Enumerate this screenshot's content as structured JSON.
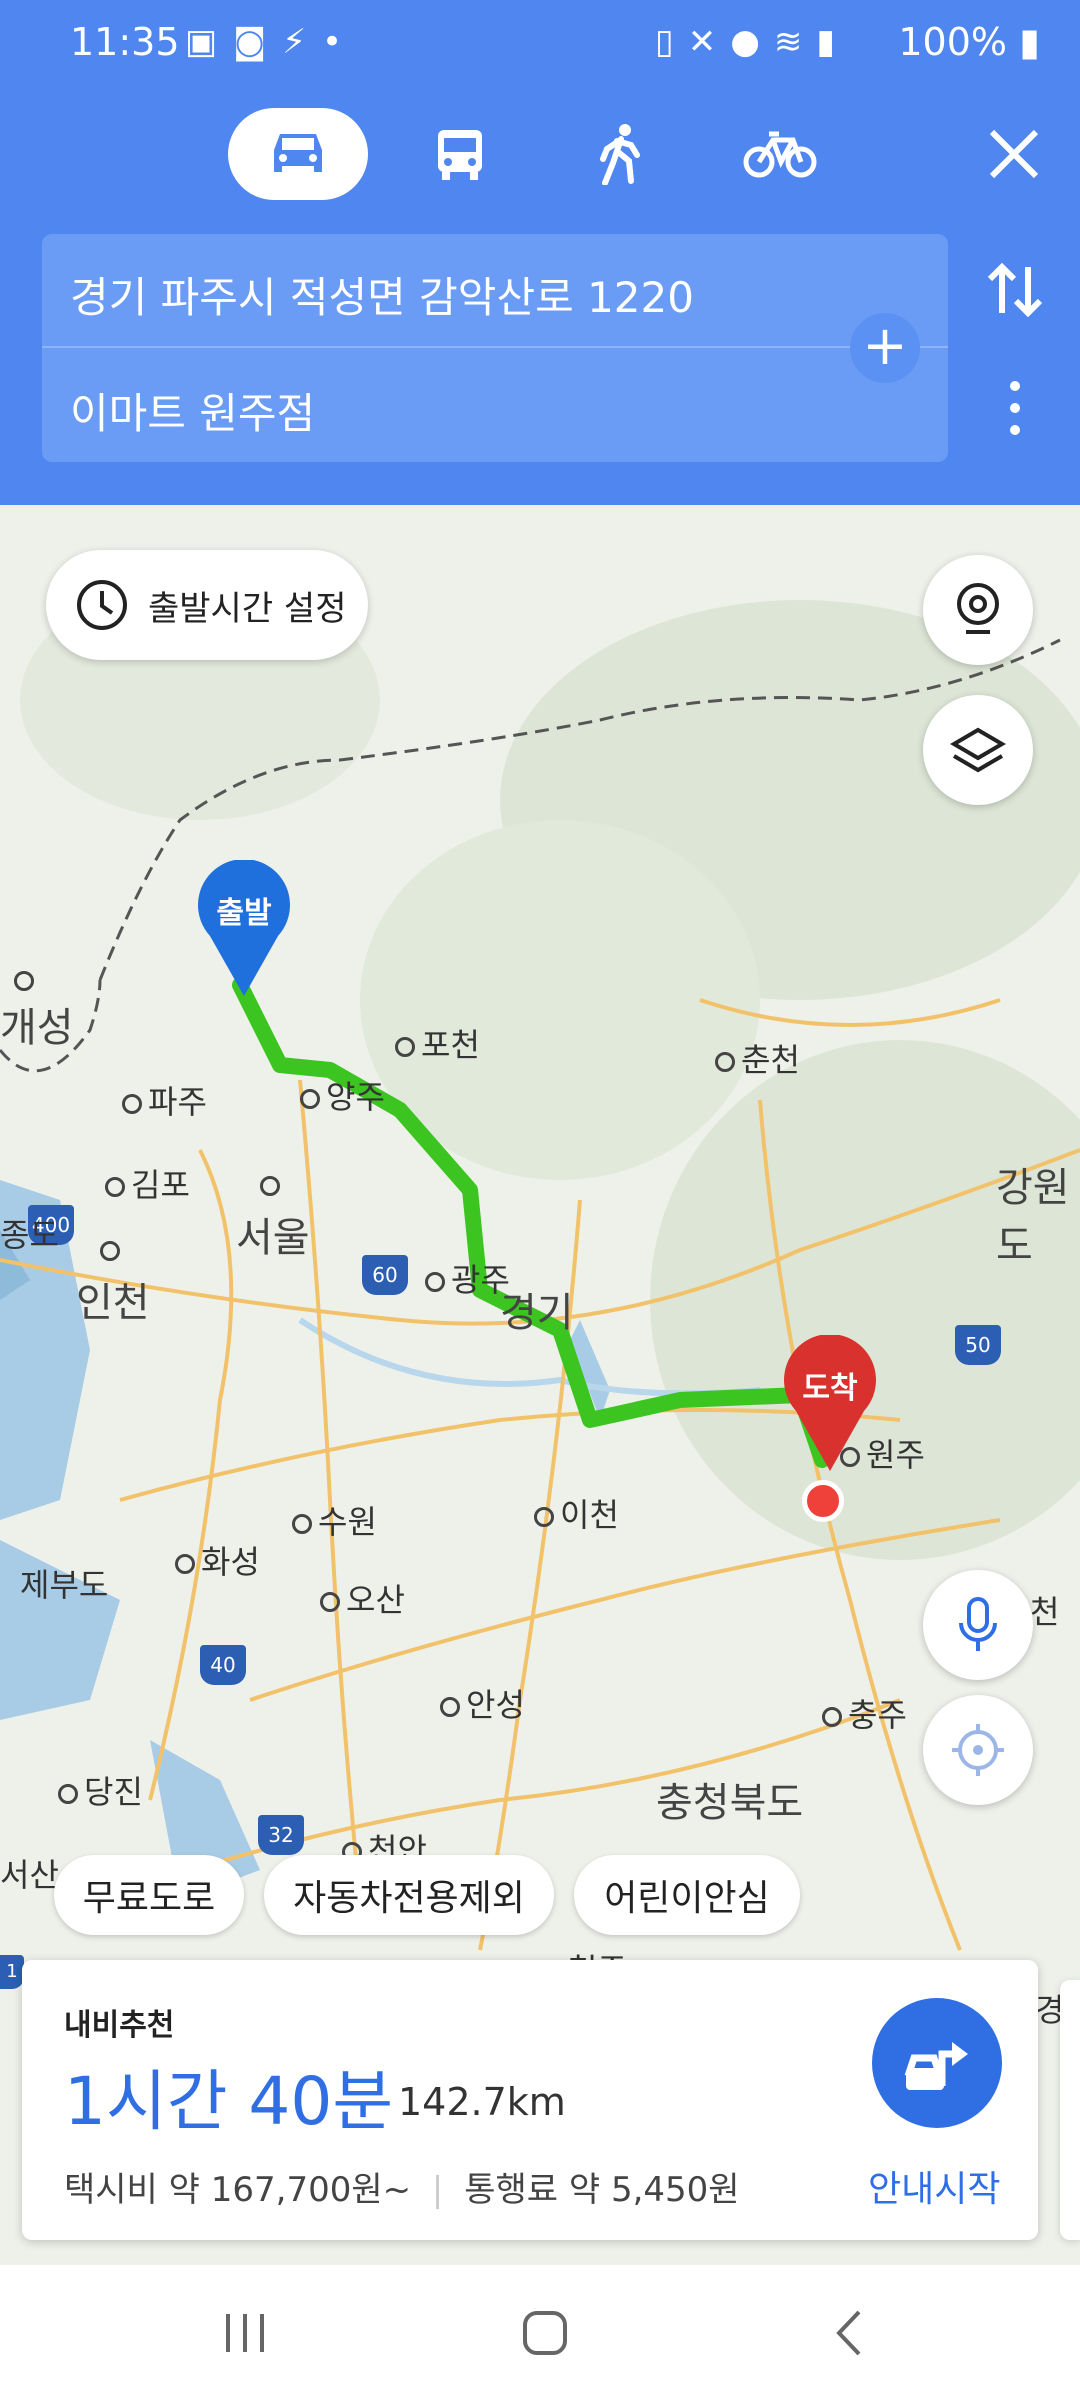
{
  "status_bar": {
    "time": "11:35",
    "battery": "100%",
    "icons_left": [
      "image-icon",
      "app-icon",
      "flash-icon",
      "dot-icon"
    ],
    "icons_right": [
      "battery-saver-icon",
      "mute-icon",
      "location-icon",
      "wifi-icon",
      "signal-icon",
      "battery-icon"
    ]
  },
  "transport_modes": [
    {
      "name": "car",
      "icon": "car-icon",
      "selected": true
    },
    {
      "name": "bus",
      "icon": "bus-icon",
      "selected": false
    },
    {
      "name": "walk",
      "icon": "walk-icon",
      "selected": false
    },
    {
      "name": "bike",
      "icon": "bike-icon",
      "selected": false
    }
  ],
  "route": {
    "origin": "경기 파주시 적성면 감악산로 1220",
    "destination": "이마트 원주점"
  },
  "map": {
    "depart_time_button": "출발시간 설정",
    "start_marker": "출발",
    "end_marker": "도착",
    "places": {
      "kaesong": "개성",
      "pocheon": "포천",
      "chuncheon": "춘천",
      "paju": "파주",
      "yangju": "양주",
      "gimpo": "김포",
      "seoul": "서울",
      "incheon": "인천",
      "gwangju": "광주",
      "gyeonggi": "경기",
      "wonju": "원주",
      "gangwon": "강원도",
      "suwon": "수원",
      "icheon": "이천",
      "hwaseong": "화성",
      "osan": "오산",
      "anseong": "안성",
      "chungju": "충주",
      "chungbuk": "충청북도",
      "dangjin": "당진",
      "cheonan": "천안",
      "jebudo": "제부도",
      "jongdo": "종도",
      "cheongju": "청주",
      "seosan": "서산",
      "jecheon": "천",
      "gyeong": "경"
    },
    "highway_shields": [
      "400",
      "60",
      "50",
      "40",
      "32",
      "1"
    ]
  },
  "filters": [
    "무료도로",
    "자동차전용제외",
    "어린이안심"
  ],
  "summary": {
    "label": "내비추천",
    "duration": "1시간 40분",
    "distance": "142.7km",
    "taxi_fare": "택시비 약 167,700원~",
    "toll": "통행료 약 5,450원",
    "start_nav": "안내시작"
  },
  "colors": {
    "header": "#4f86f0",
    "route": "#3cc421",
    "accent": "#2f6fe3",
    "start_marker": "#1f6fdc",
    "end_marker": "#d9322e"
  }
}
